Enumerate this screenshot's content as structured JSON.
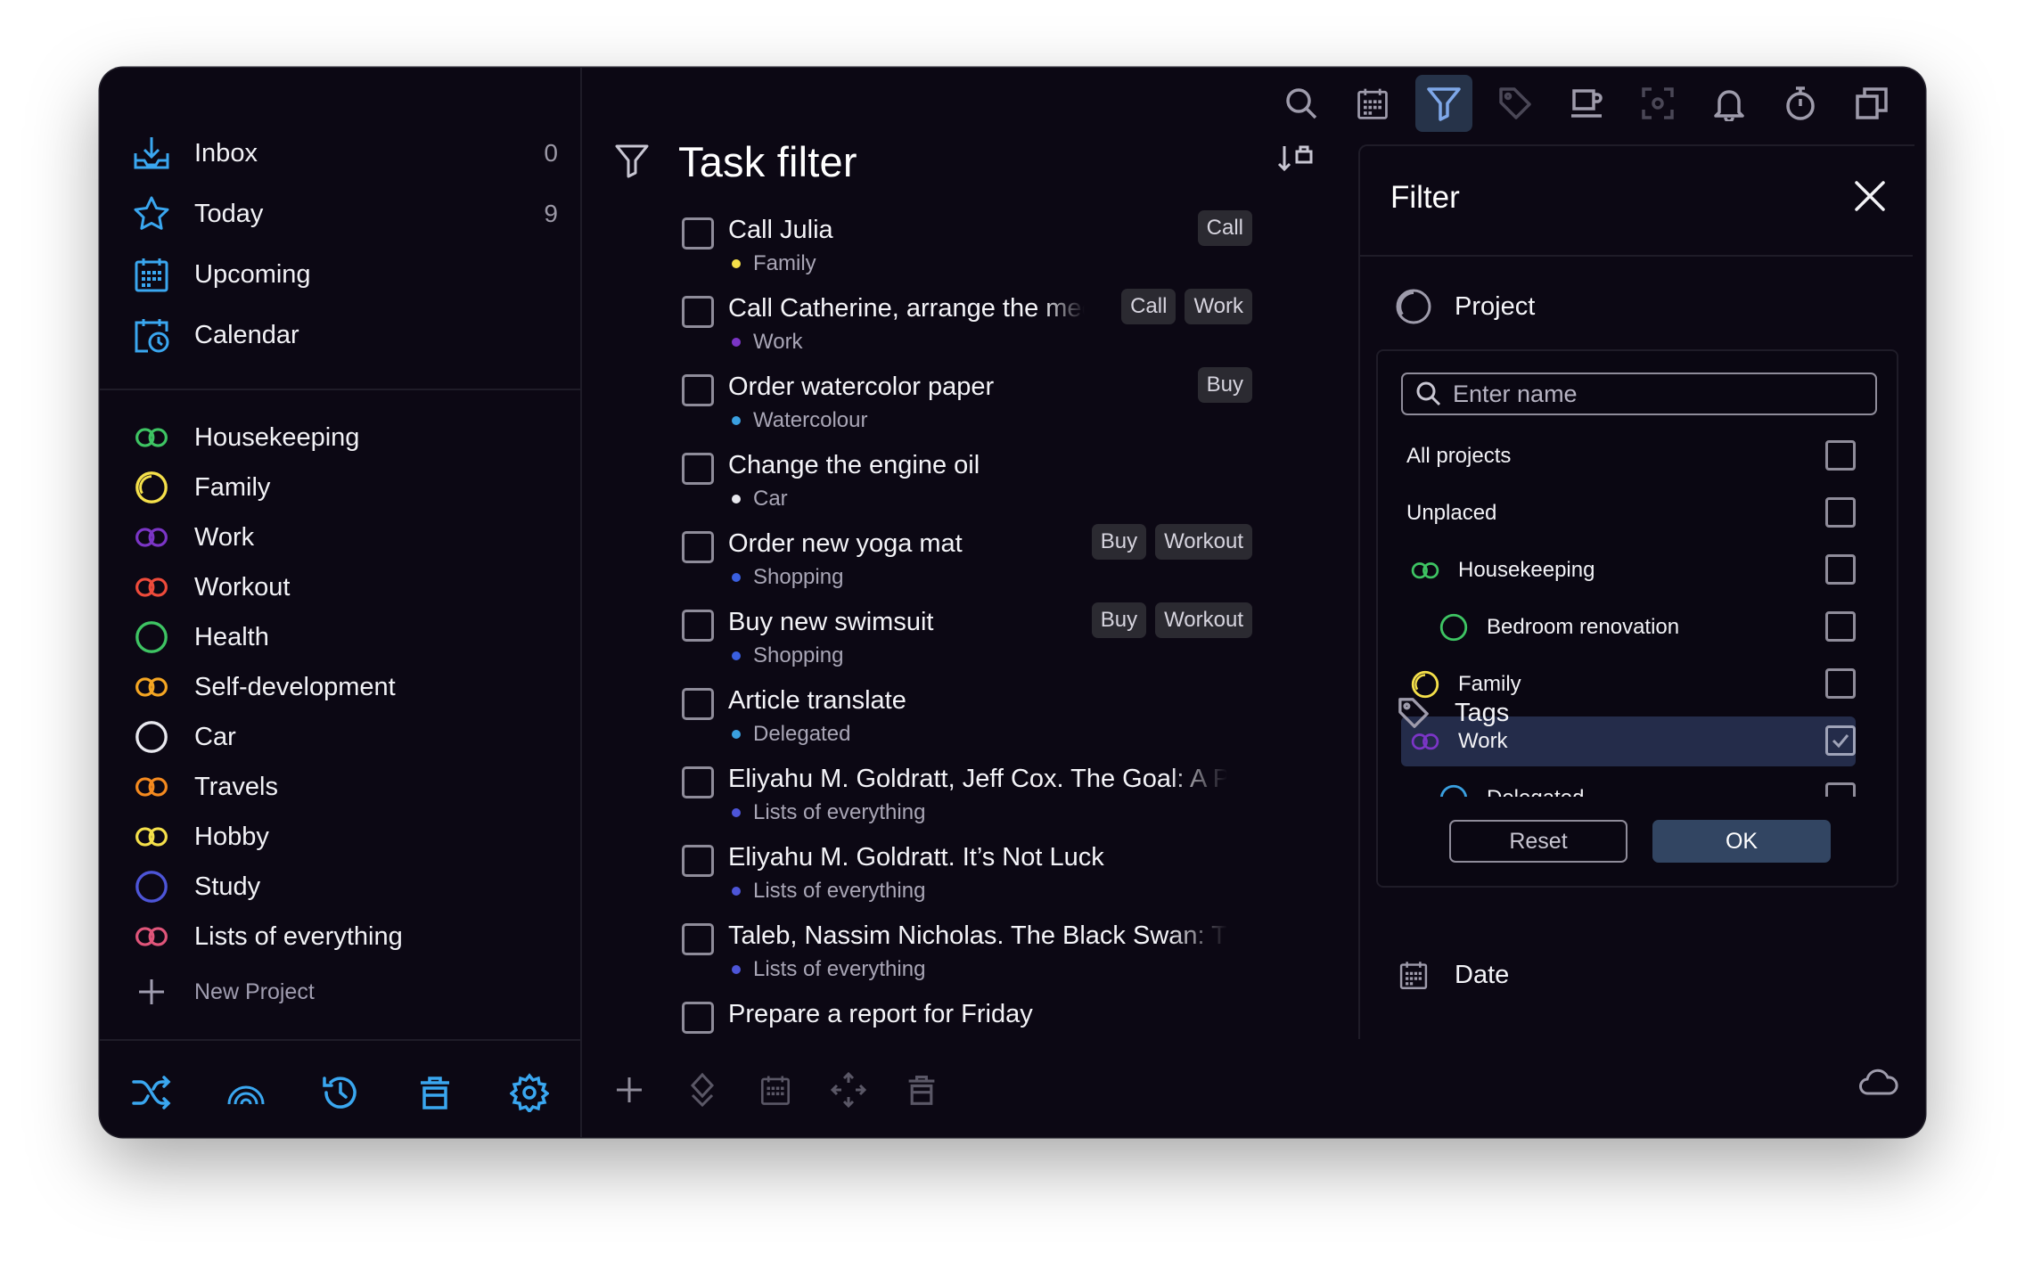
{
  "sidebar": {
    "nav": [
      {
        "label": "Inbox",
        "count": "0",
        "icon": "inbox-icon"
      },
      {
        "label": "Today",
        "count": "9",
        "icon": "star-icon"
      },
      {
        "label": "Upcoming",
        "count": "",
        "icon": "calendar-grid-icon"
      },
      {
        "label": "Calendar",
        "count": "",
        "icon": "calendar-clock-icon"
      }
    ],
    "projects": [
      {
        "label": "Housekeeping",
        "color": "#3ec463",
        "icon": "double-ring-icon"
      },
      {
        "label": "Family",
        "color": "#f5e04a",
        "icon": "partial-ring-icon"
      },
      {
        "label": "Work",
        "color": "#7b35c6",
        "icon": "double-ring-icon"
      },
      {
        "label": "Workout",
        "color": "#ef4b3b",
        "icon": "double-ring-icon"
      },
      {
        "label": "Health",
        "color": "#3ec463",
        "icon": "ring-icon"
      },
      {
        "label": "Self-development",
        "color": "#f5a623",
        "icon": "double-ring-icon"
      },
      {
        "label": "Car",
        "color": "#e8e8ee",
        "icon": "ring-icon"
      },
      {
        "label": "Travels",
        "color": "#f58a1f",
        "icon": "double-ring-icon"
      },
      {
        "label": "Hobby",
        "color": "#f5e04a",
        "icon": "double-ring-icon"
      },
      {
        "label": "Study",
        "color": "#4d55d8",
        "icon": "ring-icon"
      },
      {
        "label": "Lists of everything",
        "color": "#e0557a",
        "icon": "double-ring-icon"
      }
    ],
    "new_project": "New Project",
    "bottom_icons": [
      "shuffle-icon",
      "rainbow-icon",
      "history-icon",
      "trash-icon",
      "settings-icon"
    ]
  },
  "main": {
    "title": "Task filter",
    "tasks": [
      {
        "name": "Call Julia",
        "project": "Family",
        "dot": "#f5e04a",
        "tags": [
          "Call"
        ]
      },
      {
        "name": "Call Catherine, arrange the meeting",
        "project": "Work",
        "dot": "#7b35c6",
        "tags": [
          "Call",
          "Work"
        ]
      },
      {
        "name": "Order watercolor paper",
        "project": "Watercolour",
        "dot": "#3aa0e0",
        "tags": [
          "Buy"
        ]
      },
      {
        "name": "Change the engine oil",
        "project": "Car",
        "dot": "#e8e8ee",
        "tags": []
      },
      {
        "name": "Order new yoga mat",
        "project": "Shopping",
        "dot": "#3a5fe0",
        "tags": [
          "Buy",
          "Workout"
        ]
      },
      {
        "name": "Buy new swimsuit",
        "project": "Shopping",
        "dot": "#3a5fe0",
        "tags": [
          "Buy",
          "Workout"
        ]
      },
      {
        "name": "Article translate",
        "project": "Delegated",
        "dot": "#3aa0e0",
        "tags": []
      },
      {
        "name": "Eliyahu M. Goldratt, Jeff Cox. The Goal: A Process",
        "project": "Lists of everything",
        "dot": "#4d55d8",
        "tags": []
      },
      {
        "name": "Eliyahu M. Goldratt. It’s Not Luck",
        "project": "Lists of everything",
        "dot": "#4d55d8",
        "tags": []
      },
      {
        "name": "Taleb, Nassim Nicholas. The Black Swan: The",
        "project": "Lists of everything",
        "dot": "#4d55d8",
        "tags": []
      },
      {
        "name": "Prepare a report for Friday",
        "project": "",
        "dot": "#7b35c6",
        "tags": []
      }
    ]
  },
  "toolbar": {
    "icons": [
      "search-icon",
      "calendar-icon",
      "filter-icon",
      "tag-icon",
      "coffee-icon",
      "focus-icon",
      "bell-icon",
      "timer-icon",
      "copy-icon"
    ],
    "active": "filter-icon"
  },
  "filter": {
    "title": "Filter",
    "project_section": "Project",
    "search_placeholder": "Enter name",
    "rows": [
      {
        "label": "All projects",
        "checked": false,
        "indent": 0,
        "icon": ""
      },
      {
        "label": "Unplaced",
        "checked": false,
        "indent": 0,
        "icon": ""
      },
      {
        "label": "Housekeeping",
        "checked": false,
        "indent": 0,
        "icon": "double-ring-icon"
      },
      {
        "label": "Bedroom renovation",
        "checked": false,
        "indent": 1,
        "icon": "ring-icon"
      },
      {
        "label": "Family",
        "checked": false,
        "indent": 0,
        "icon": "partial-ring-icon"
      },
      {
        "label": "Work",
        "checked": true,
        "indent": 0,
        "icon": "double-ring-icon"
      },
      {
        "label": "Delegated",
        "checked": false,
        "indent": 1,
        "icon": "ring-icon"
      }
    ],
    "reset_label": "Reset",
    "ok_label": "OK",
    "tags_section": "Tags",
    "date_section": "Date"
  }
}
